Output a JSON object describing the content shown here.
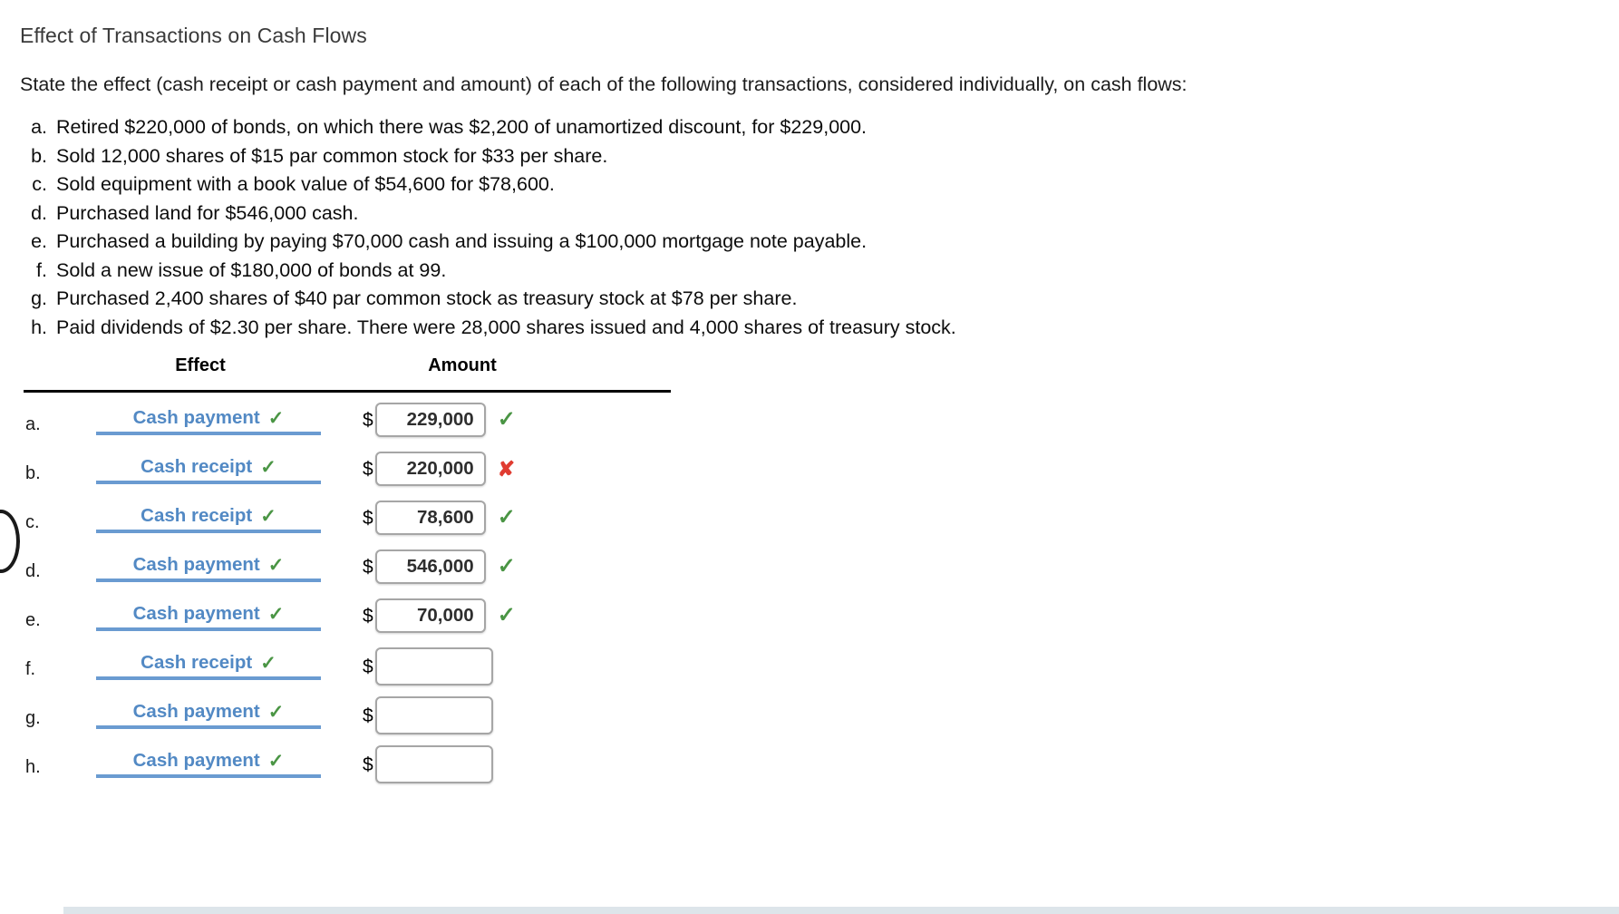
{
  "page_title": "Effect of Transactions on Cash Flows",
  "prompt": "State the effect (cash receipt or cash payment and amount) of each of the following transactions, considered individually, on cash flows:",
  "transactions": [
    {
      "letter": "a.",
      "text": "Retired $220,000 of bonds, on which there was $2,200 of unamortized discount, for $229,000."
    },
    {
      "letter": "b.",
      "text": "Sold 12,000 shares of $15 par common stock for $33 per share."
    },
    {
      "letter": "c.",
      "text": "Sold equipment with a book value of $54,600 for $78,600."
    },
    {
      "letter": "d.",
      "text": "Purchased land for $546,000 cash."
    },
    {
      "letter": "e.",
      "text": "Purchased a building by paying $70,000 cash and issuing a $100,000 mortgage note payable."
    },
    {
      "letter": "f.",
      "text": "Sold a new issue of $180,000 of bonds at 99."
    },
    {
      "letter": "g.",
      "text": "Purchased 2,400 shares of $40 par common stock as treasury stock at $78 per share."
    },
    {
      "letter": "h.",
      "text": "Paid dividends of $2.30 per share. There were 28,000 shares issued and 4,000 shares of treasury stock."
    }
  ],
  "answer_table": {
    "headers": {
      "effect": "Effect",
      "amount": "Amount"
    },
    "currency_symbol": "$",
    "check_glyph": "✓",
    "cross_glyph": "✘",
    "colors": {
      "link_blue": "#5289c4",
      "underline_blue": "#6a9bd1",
      "correct_green": "#4a9544",
      "incorrect_red": "#e03c31"
    },
    "rows": [
      {
        "letter": "a.",
        "effect": "Cash payment",
        "effect_status": "correct",
        "amount": "229,000",
        "amount_status": "correct"
      },
      {
        "letter": "b.",
        "effect": "Cash receipt",
        "effect_status": "correct",
        "amount": "220,000",
        "amount_status": "incorrect"
      },
      {
        "letter": "c.",
        "effect": "Cash receipt",
        "effect_status": "correct",
        "amount": "78,600",
        "amount_status": "correct"
      },
      {
        "letter": "d.",
        "effect": "Cash payment",
        "effect_status": "correct",
        "amount": "546,000",
        "amount_status": "correct"
      },
      {
        "letter": "e.",
        "effect": "Cash payment",
        "effect_status": "correct",
        "amount": "70,000",
        "amount_status": "correct"
      },
      {
        "letter": "f.",
        "effect": "Cash receipt",
        "effect_status": "correct",
        "amount": "",
        "amount_status": "none"
      },
      {
        "letter": "g.",
        "effect": "Cash payment",
        "effect_status": "correct",
        "amount": "",
        "amount_status": "none"
      },
      {
        "letter": "h.",
        "effect": "Cash payment",
        "effect_status": "correct",
        "amount": "",
        "amount_status": "none"
      }
    ]
  }
}
